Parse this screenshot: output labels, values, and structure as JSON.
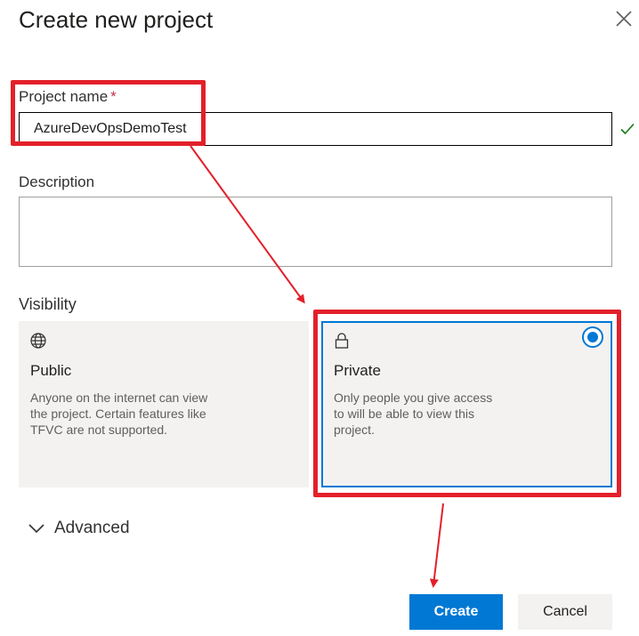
{
  "dialog": {
    "title": "Create new project"
  },
  "project_name": {
    "label": "Project name",
    "required_marker": "*",
    "value": "AzureDevOpsDemoTest"
  },
  "description": {
    "label": "Description",
    "value": ""
  },
  "visibility": {
    "label": "Visibility",
    "selected": "Private",
    "options": [
      {
        "title": "Public",
        "icon": "globe-icon",
        "description": "Anyone on the internet can view the project. Certain features like TFVC are not supported."
      },
      {
        "title": "Private",
        "icon": "lock-icon",
        "description": "Only people you give access to will be able to view this project."
      }
    ]
  },
  "advanced": {
    "label": "Advanced",
    "icon": "chevron-down-icon"
  },
  "buttons": {
    "create": "Create",
    "cancel": "Cancel"
  },
  "colors": {
    "accent": "#0078d4",
    "annotation": "#e3202a",
    "card_bg": "#f3f2f1",
    "valid_check": "#107c10"
  }
}
